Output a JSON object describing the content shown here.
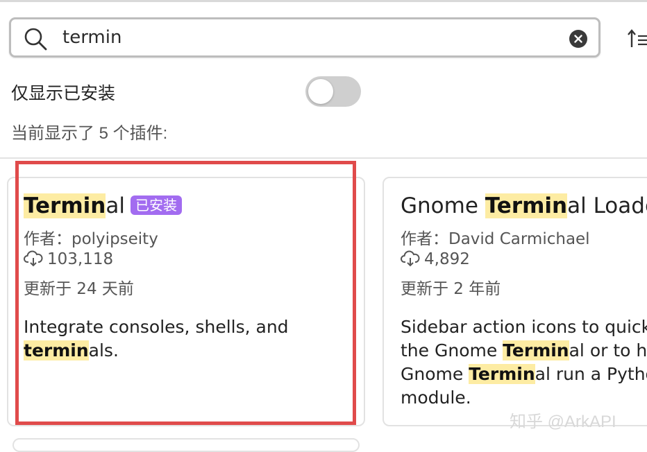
{
  "search": {
    "value": "termin"
  },
  "filter": {
    "installed_only_label": "仅显示已安装",
    "installed_only_enabled": false
  },
  "results": {
    "count_text": "当前显示了 5 个插件:"
  },
  "plugins": [
    {
      "name_match": "Termin",
      "name_rest": "al",
      "installed_badge": "已安装",
      "author": "作者：polyipseity",
      "downloads": "103,118",
      "updated": "更新于 24 天前",
      "desc_line1": "Integrate consoles, shells, and",
      "desc_line2_match": "termin",
      "desc_line2_rest": "als."
    },
    {
      "name_pre": "Gnome ",
      "name_match": "Termin",
      "name_rest": "al Loader",
      "author": "作者：David Carmichael",
      "downloads": "4,892",
      "updated": "更新于 2 年前",
      "desc_line1": "Sidebar action icons to quick",
      "desc_line2_pre": "the Gnome ",
      "desc_line2_match": "Termin",
      "desc_line2_rest": "al or to ha",
      "desc_line3_pre": "Gnome ",
      "desc_line3_match": "Termin",
      "desc_line3_rest": "al run a Pytho",
      "desc_line4": "module."
    }
  ],
  "watermark": "知乎 @ArkAPI",
  "colors": {
    "highlight": "#fdeca3",
    "badge": "#a26cf0",
    "selection_border": "#e04b4b"
  }
}
